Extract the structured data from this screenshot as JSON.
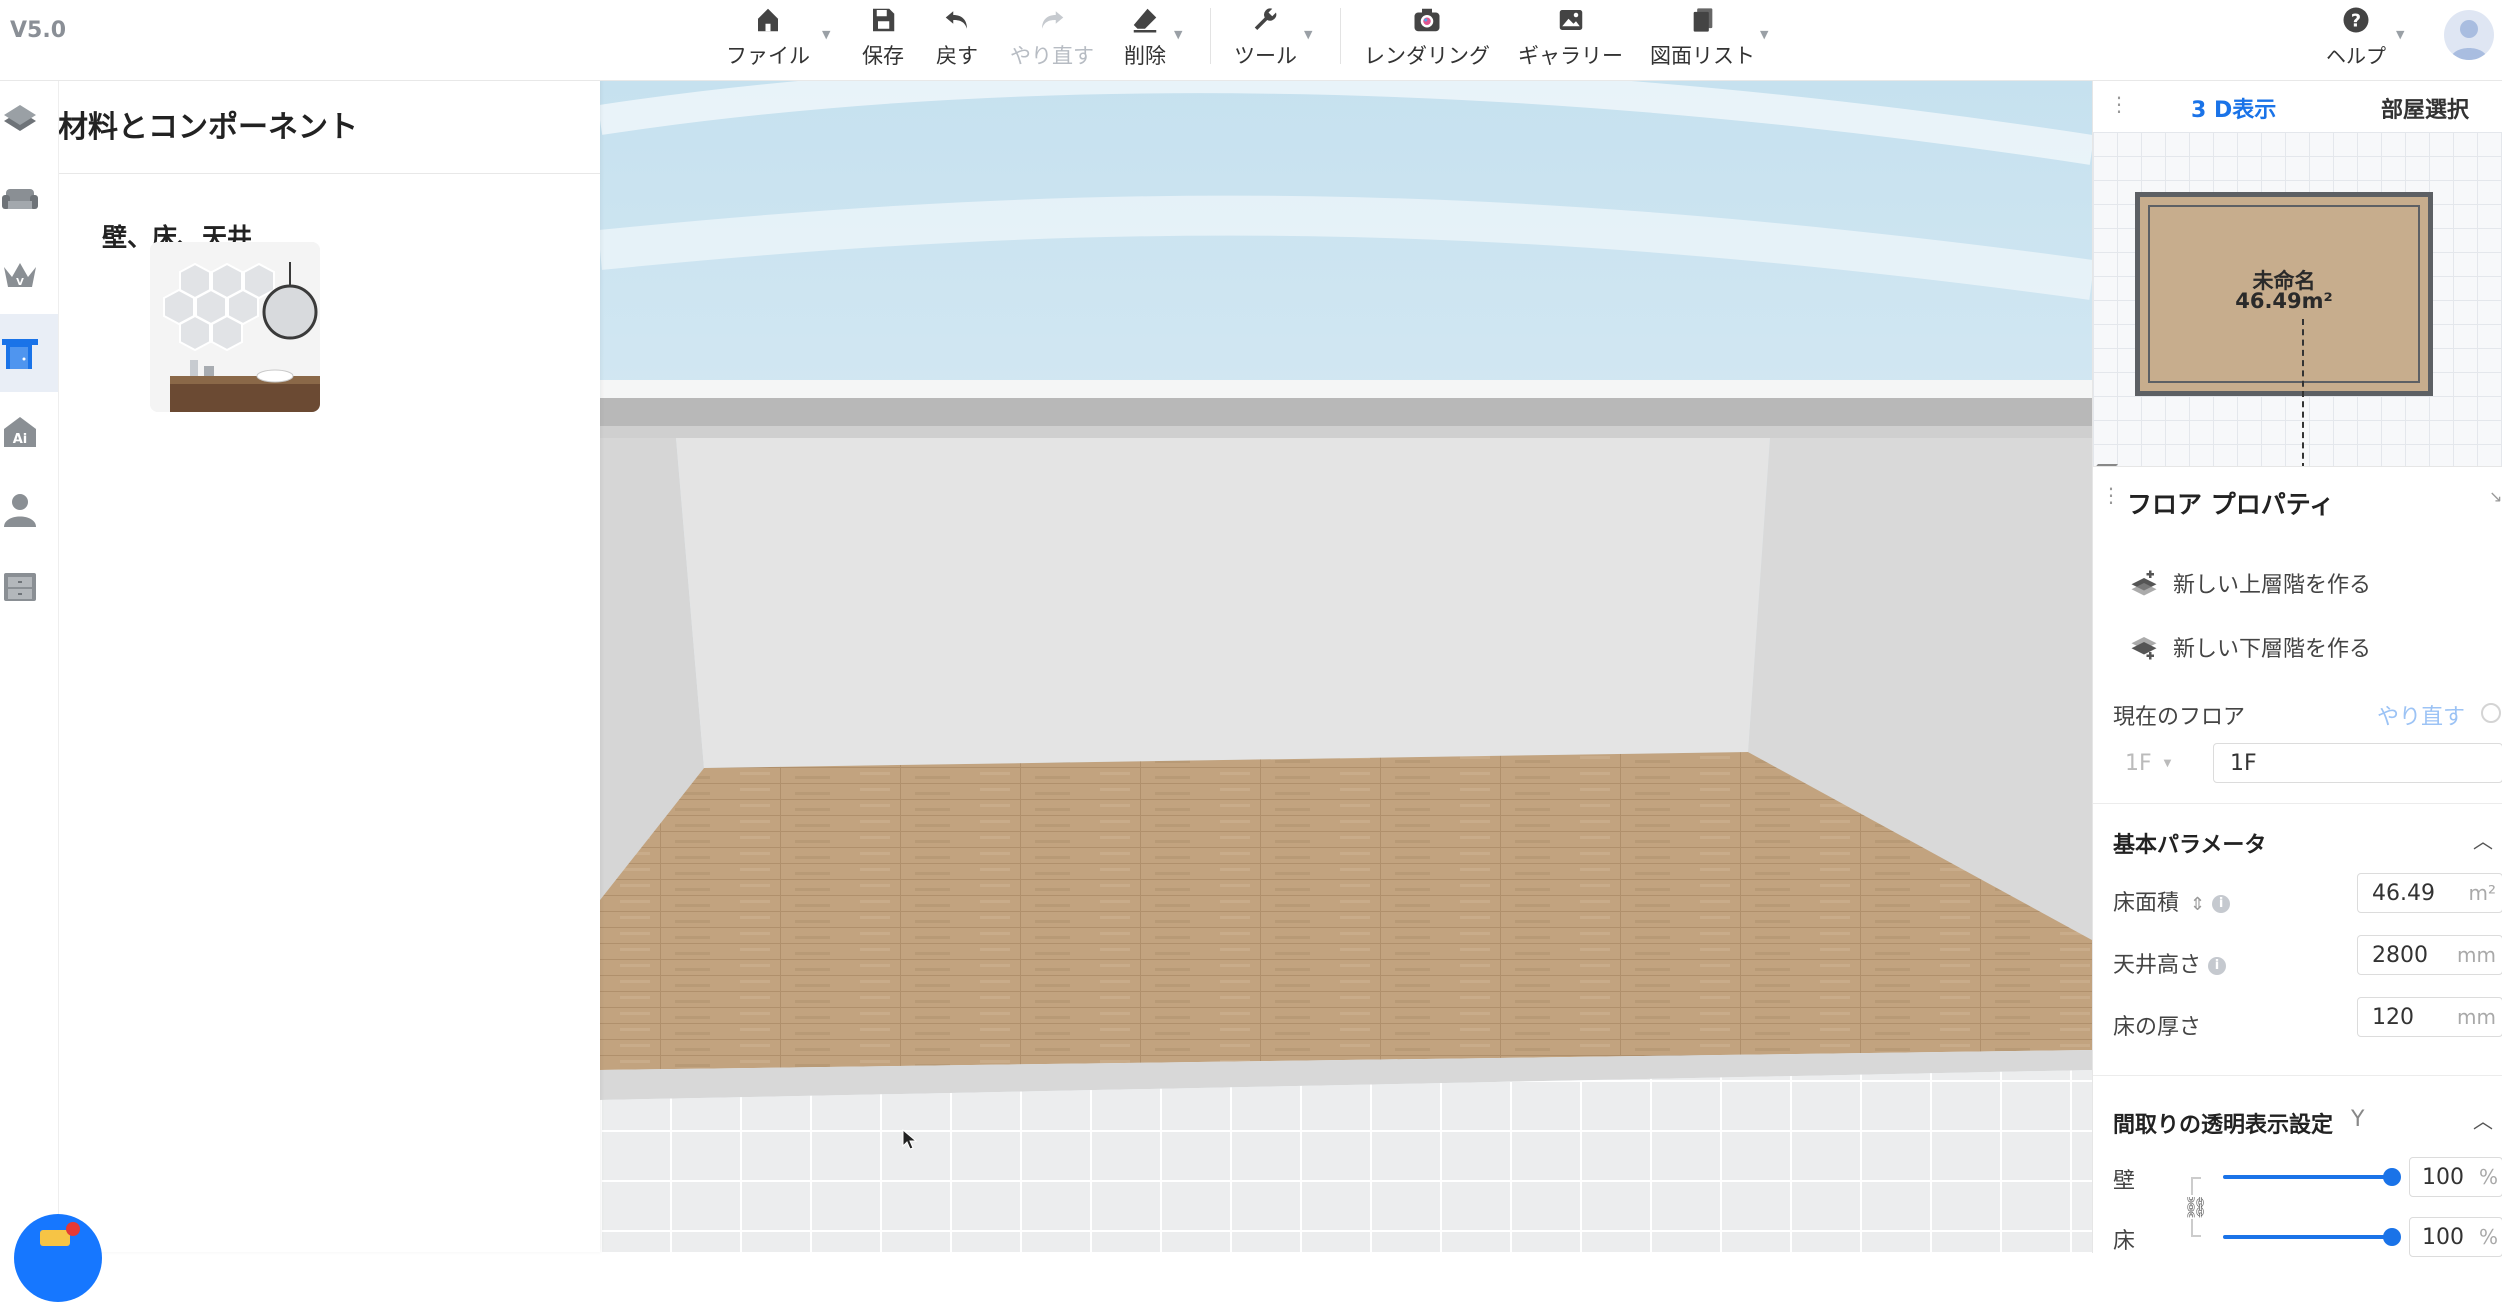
{
  "app": {
    "version": "V5.0"
  },
  "toolbar": {
    "file": "ファイル",
    "save": "保存",
    "undo": "戻す",
    "redo": "やり直す",
    "delete": "削除",
    "tools": "ツール",
    "rendering": "レンダリング",
    "gallery": "ギャラリー",
    "drawing_list": "図面リスト",
    "help": "ヘルプ"
  },
  "rail": {
    "items": [
      "floor-plan",
      "furniture",
      "premium",
      "doors-windows",
      "ai",
      "person",
      "cabinet"
    ],
    "active": "doors-windows"
  },
  "materials": {
    "title": "材料とコンポーネント",
    "category": "壁、床、天井"
  },
  "minimap": {
    "tab_3d": "3 D表示",
    "tab_room": "部屋選択",
    "room_name": "未命名",
    "room_area": "46.49m²"
  },
  "props": {
    "title": "フロア プロパティ",
    "new_upper": "新しい上層階を作る",
    "new_lower": "新しい下層階を作る",
    "current_floor_label": "現在のフロア",
    "redo": "やり直す",
    "floor_select": "1F",
    "floor_name": "1F",
    "basic_title": "基本パラメータ",
    "area_label": "床面積",
    "area_value": "46.49",
    "area_unit": "m²",
    "ceiling_label": "天井高さ",
    "ceiling_value": "2800",
    "ceiling_unit": "mm",
    "thickness_label": "床の厚さ",
    "thickness_value": "120",
    "thickness_unit": "mm",
    "transparency_title": "間取りの透明表示設定",
    "transparency_key": "Y",
    "wall_label": "壁",
    "wall_value": "100",
    "floor_label": "床",
    "floor_value": "100",
    "percent": "%"
  },
  "colors": {
    "accent": "#1a73e8",
    "floor_wood": "#c2a37f",
    "wall": "#e2e2e2"
  }
}
